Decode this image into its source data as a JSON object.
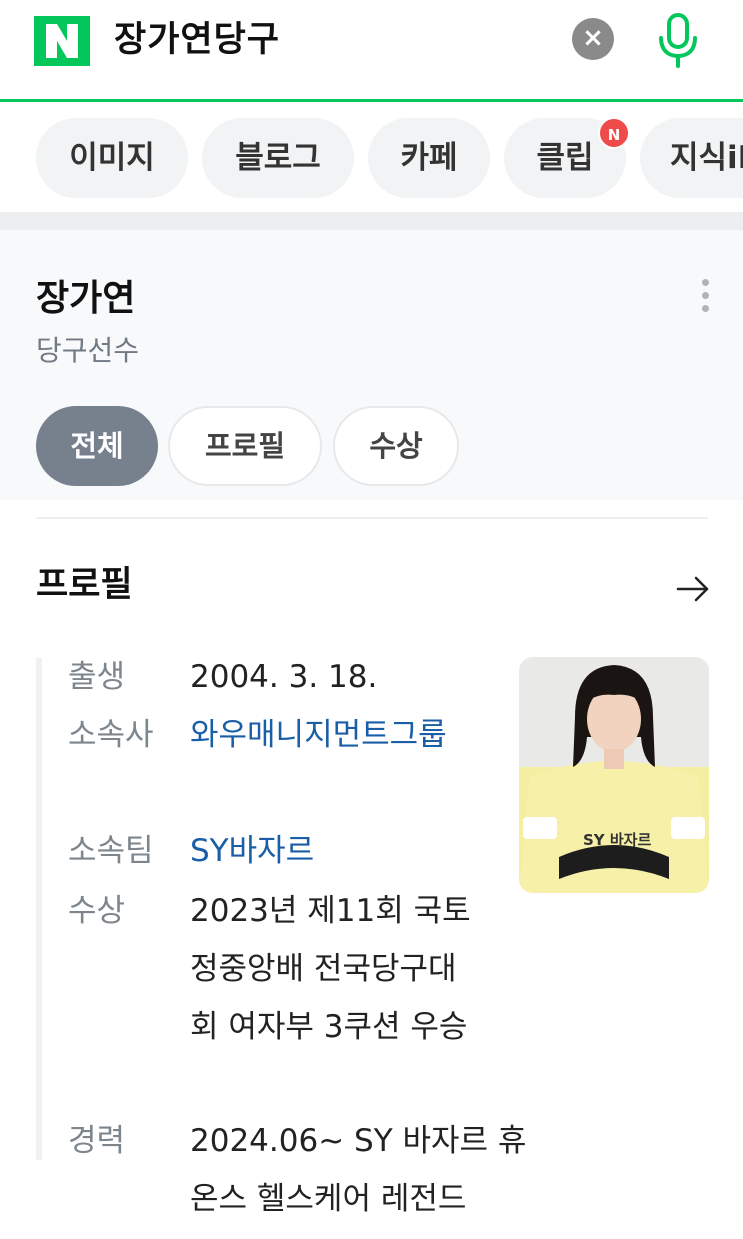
{
  "search": {
    "logo_letter": "N",
    "query": "장가연당구",
    "clear_label": "×"
  },
  "tabs": [
    {
      "label": "이미지"
    },
    {
      "label": "블로그"
    },
    {
      "label": "카페"
    },
    {
      "label": "클립",
      "badge": "N"
    },
    {
      "label": "지식iN"
    }
  ],
  "profile_card": {
    "name": "장가연",
    "occupation": "당구선수",
    "filters": [
      {
        "label": "전체",
        "active": true
      },
      {
        "label": "프로필",
        "active": false
      },
      {
        "label": "수상",
        "active": false
      }
    ],
    "section_title": "프로필",
    "rows": {
      "birth": {
        "label": "출생",
        "value": "2004. 3. 18."
      },
      "agency": {
        "label": "소속사",
        "value": "와우매니지먼트그룹"
      },
      "team": {
        "label": "소속팀",
        "value": "SY바자르"
      },
      "award": {
        "label": "수상",
        "value": "2023년 제11회 국토정중앙배 전국당구대회 여자부 3쿠션 우승"
      },
      "career": {
        "label": "경력",
        "value": "2024.06~ SY 바자르 휴온스 헬스케어 레전드"
      }
    },
    "photo_text": "SY 바자르"
  },
  "colors": {
    "brand": "#03c75a",
    "link": "#1a5ea8",
    "badge": "#f04b4b",
    "active_chip": "#76818d"
  }
}
